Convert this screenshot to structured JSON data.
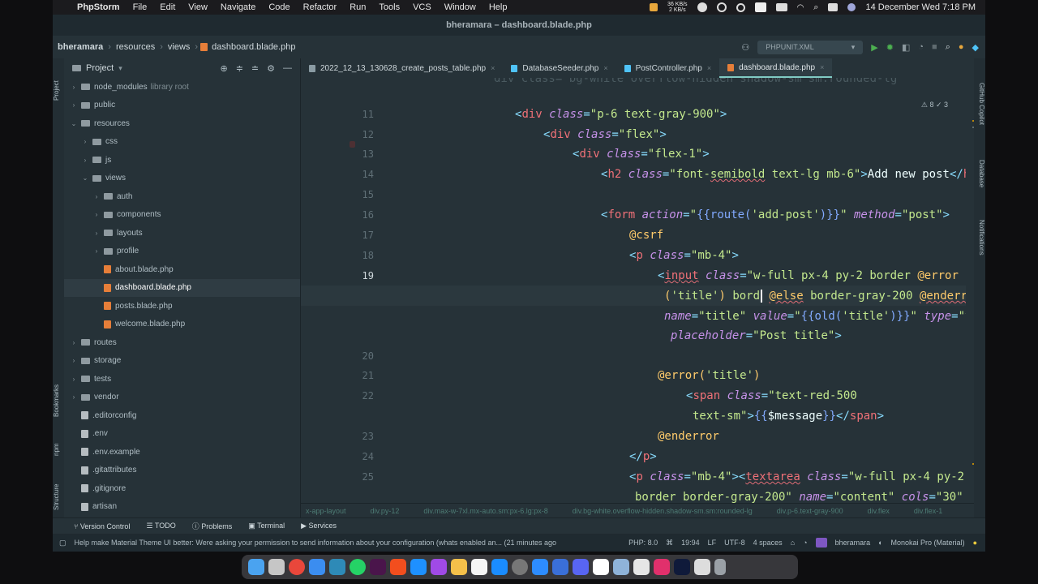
{
  "menubar": {
    "app": "PhpStorm",
    "items": [
      "File",
      "Edit",
      "View",
      "Navigate",
      "Code",
      "Refactor",
      "Run",
      "Tools",
      "VCS",
      "Window",
      "Help"
    ],
    "net_up": "36 KB/s",
    "net_down": "2 KB/s",
    "datetime": "14 December Wed  7:18 PM"
  },
  "window": {
    "title": "bheramara – dashboard.blade.php"
  },
  "toolbar": {
    "breadcrumb": [
      "bheramara",
      "resources",
      "views",
      "dashboard.blade.php"
    ],
    "run_config": "PHPUNIT.XML"
  },
  "project": {
    "header": "Project",
    "tree": [
      {
        "label": "node_modules",
        "extra": "library root",
        "type": "folder",
        "depth": 0,
        "open": false
      },
      {
        "label": "public",
        "type": "folder",
        "depth": 0,
        "open": false
      },
      {
        "label": "resources",
        "type": "folder",
        "depth": 0,
        "open": true
      },
      {
        "label": "css",
        "type": "folder",
        "depth": 1,
        "open": false
      },
      {
        "label": "js",
        "type": "folder",
        "depth": 1,
        "open": false
      },
      {
        "label": "views",
        "type": "folder",
        "depth": 1,
        "open": true
      },
      {
        "label": "auth",
        "type": "folder",
        "depth": 2,
        "open": false
      },
      {
        "label": "components",
        "type": "folder",
        "depth": 2,
        "open": false
      },
      {
        "label": "layouts",
        "type": "folder",
        "depth": 2,
        "open": false
      },
      {
        "label": "profile",
        "type": "folder",
        "depth": 2,
        "open": false
      },
      {
        "label": "about.blade.php",
        "type": "blade",
        "depth": 2
      },
      {
        "label": "dashboard.blade.php",
        "type": "blade",
        "depth": 2,
        "selected": true
      },
      {
        "label": "posts.blade.php",
        "type": "blade",
        "depth": 2
      },
      {
        "label": "welcome.blade.php",
        "type": "blade",
        "depth": 2
      },
      {
        "label": "routes",
        "type": "folder",
        "depth": 0,
        "open": false
      },
      {
        "label": "storage",
        "type": "folder",
        "depth": 0,
        "open": false
      },
      {
        "label": "tests",
        "type": "folder",
        "depth": 0,
        "open": false
      },
      {
        "label": "vendor",
        "type": "folder",
        "depth": 0,
        "open": false
      },
      {
        "label": ".editorconfig",
        "type": "file",
        "depth": 0
      },
      {
        "label": ".env",
        "type": "file",
        "depth": 0
      },
      {
        "label": ".env.example",
        "type": "file",
        "depth": 0
      },
      {
        "label": ".gitattributes",
        "type": "file",
        "depth": 0
      },
      {
        "label": ".gitignore",
        "type": "file",
        "depth": 0
      },
      {
        "label": "artisan",
        "type": "file",
        "depth": 0
      }
    ]
  },
  "tabs": [
    {
      "label": "2022_12_13_130628_create_posts_table.php",
      "color": "#8a9ba3"
    },
    {
      "label": "DatabaseSeeder.php",
      "color": "#4fc3f7"
    },
    {
      "label": "PostController.php",
      "color": "#4fc3f7"
    },
    {
      "label": "dashboard.blade.php",
      "color": "#e67e39",
      "active": true
    }
  ],
  "editor": {
    "inspection": "⚠ 8  ✓ 3",
    "line_numbers": [
      "11",
      "12",
      "13",
      "14",
      "15",
      "16",
      "17",
      "18",
      "19",
      "20",
      "21",
      "22",
      "23",
      "24",
      "25"
    ]
  },
  "breadcrumb_bar": [
    "x-app-layout",
    "div.py-12",
    "div.max-w-7xl.mx-auto.sm:px-6.lg:px-8",
    "div.bg-white.overflow-hidden.shadow-sm.sm:rounded-lg",
    "div.p-6.text-gray-900",
    "div.flex",
    "div.flex-1"
  ],
  "bottom_tabs": [
    "Version Control",
    "TODO",
    "Problems",
    "Terminal",
    "Services"
  ],
  "side_tools_left": [
    "Project",
    "Bookmarks",
    "npm",
    "Structure"
  ],
  "side_tools_right": [
    "GitHub Copilot",
    "Database",
    "Notifications"
  ],
  "statusbar": {
    "message": "Help make Material Theme UI better: Were asking your permission to send information about your configuration (whats enabled an... (21 minutes ago",
    "php": "PHP: 8.0",
    "position": "19:94",
    "line_sep": "LF",
    "encoding": "UTF-8",
    "indent": "4 spaces",
    "project": "bheramara",
    "theme": "Monokai Pro (Material)"
  },
  "colors": {
    "accent": "#80cbc4",
    "blade": "#e67e39",
    "bg": "#263238"
  }
}
